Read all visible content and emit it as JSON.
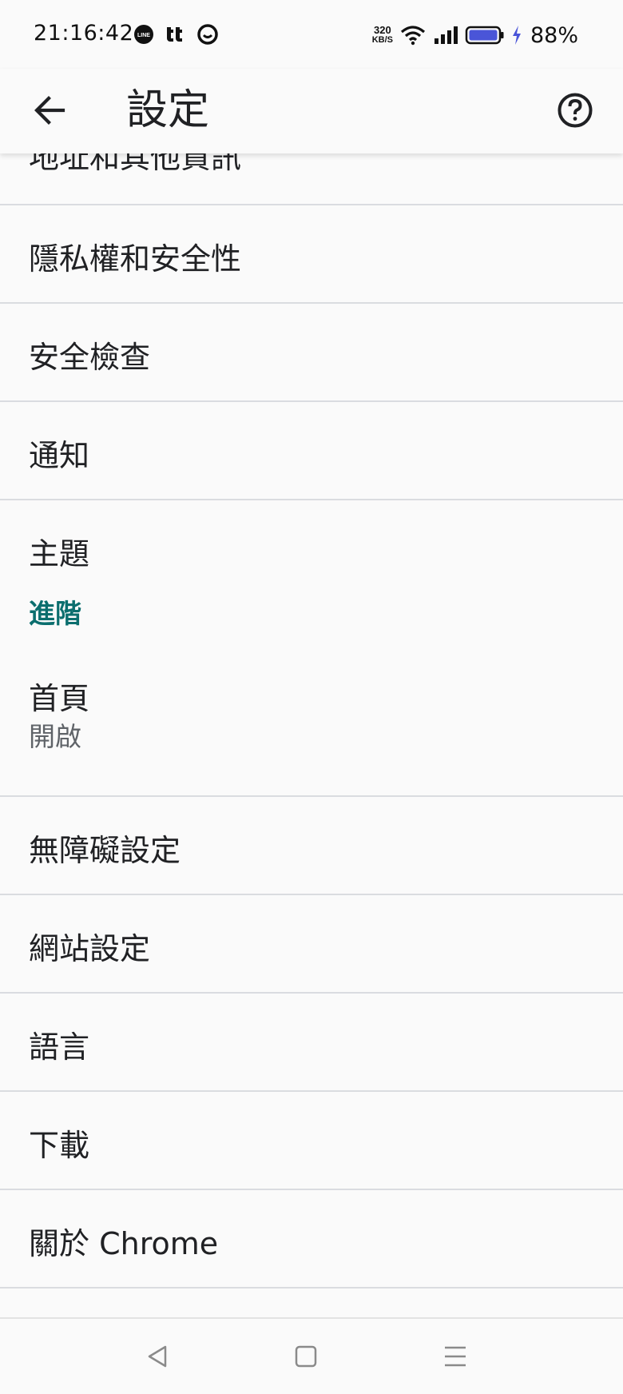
{
  "status_bar": {
    "time": "21:16:42",
    "net_speed_value": "320",
    "net_speed_unit": "KB/S",
    "battery_percent": "88%",
    "app_icons": [
      "line-icon",
      "tt-icon",
      "smiley-icon"
    ],
    "system_icons": [
      "wifi-icon",
      "signal-icon",
      "battery-icon",
      "charging-icon"
    ]
  },
  "toolbar": {
    "title": "設定",
    "back_icon": "arrow-left-icon",
    "help_icon": "help-circle-icon"
  },
  "settings": {
    "partial_item": "地址和其他資訊",
    "items_basic": [
      {
        "label": "隱私權和安全性"
      },
      {
        "label": "安全檢查"
      },
      {
        "label": "通知"
      },
      {
        "label": "主題"
      }
    ],
    "advanced_header": "進階",
    "homepage": {
      "label": "首頁",
      "sub": "開啟"
    },
    "items_advanced": [
      {
        "label": "無障礙設定"
      },
      {
        "label": "網站設定"
      },
      {
        "label": "語言"
      },
      {
        "label": "下載"
      },
      {
        "label": "關於 Chrome"
      }
    ]
  },
  "nav_bar": {
    "back_icon": "nav-back-icon",
    "home_icon": "nav-home-icon",
    "menu_icon": "nav-menu-icon"
  },
  "colors": {
    "accent": "#0b6e6e",
    "text": "#202124",
    "secondary_text": "#5f6368",
    "divider": "#dadce0",
    "background": "#fafafa",
    "battery": "#4a55d8"
  }
}
